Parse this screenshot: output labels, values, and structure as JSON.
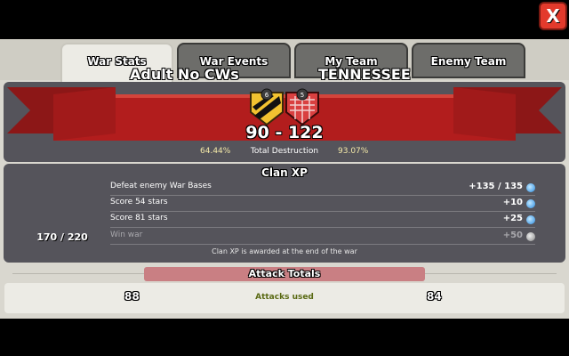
{
  "tabs": [
    {
      "label": "War Stats",
      "active": true
    },
    {
      "label": "War Events",
      "active": false
    },
    {
      "label": "My Team",
      "active": false
    },
    {
      "label": "Enemy Team",
      "active": false
    }
  ],
  "close_label": "X",
  "war": {
    "my_clan": "Adult No CWs",
    "enemy_clan": "TENNESSEE",
    "my_badge_level": "6",
    "enemy_badge_level": "5",
    "score": "90 - 122",
    "my_destruction": "64.44%",
    "destruction_label": "Total Destruction",
    "enemy_destruction": "93.07%"
  },
  "clan_xp": {
    "title": "Clan XP",
    "count": "170 / 220",
    "rows": [
      {
        "label": "Defeat enemy War Bases",
        "value": "+135 / 135"
      },
      {
        "label": "Score 54 stars",
        "value": "+10"
      },
      {
        "label": "Score 81 stars",
        "value": "+25"
      },
      {
        "label": "Win war",
        "value": "+50"
      }
    ],
    "note": "Clan XP is awarded at the end of the war"
  },
  "attack_totals": {
    "title": "Attack Totals",
    "left_value": "88",
    "label": "Attacks used",
    "right_value": "84"
  },
  "colors": {
    "ribbon": "#b21d1d",
    "panel": "#55545b",
    "close": "#e33a2c"
  }
}
